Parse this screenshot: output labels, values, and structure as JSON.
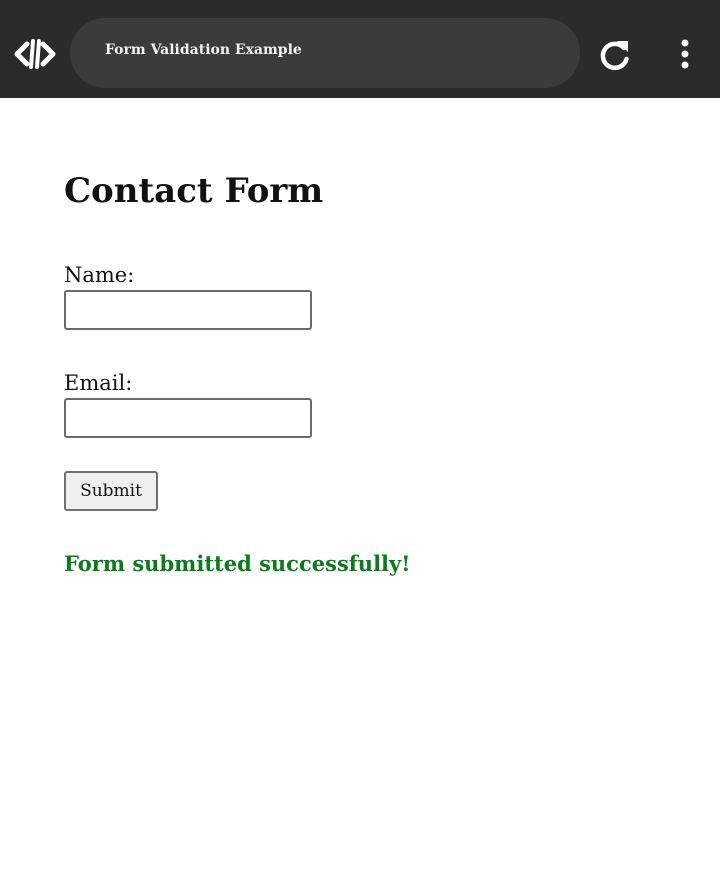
{
  "browser": {
    "tab_title": "Form Validation Example",
    "logo_icon": "code-brackets-icon",
    "reload_icon": "reload-icon",
    "menu_icon": "more-vertical-icon"
  },
  "page": {
    "title": "Contact Form",
    "name_label": "Name:",
    "name_value": "",
    "email_label": "Email:",
    "email_value": "",
    "submit_label": "Submit",
    "success_message": "Form submitted successfully!",
    "success_color": "#0a7d1b"
  }
}
